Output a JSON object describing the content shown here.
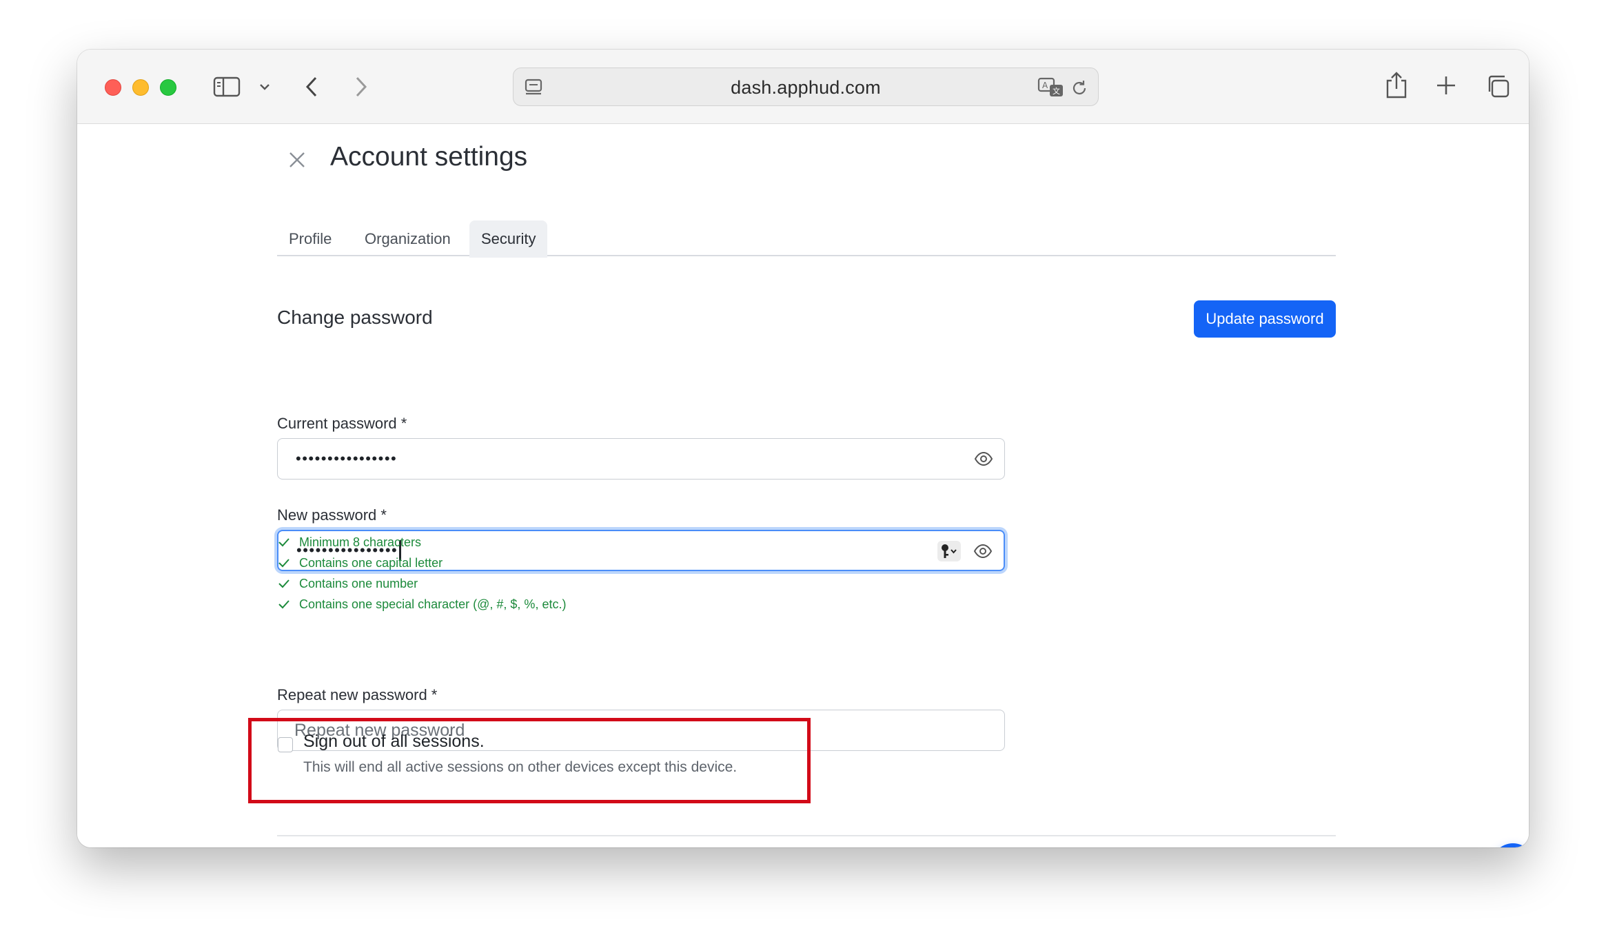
{
  "browser": {
    "url": "dash.apphud.com",
    "icons": [
      "sidebar-icon",
      "chevron-down-icon",
      "back-icon",
      "forward-icon",
      "page-menu-icon",
      "translate-icon",
      "reload-icon",
      "share-icon",
      "new-tab-icon",
      "tabs-overview-icon"
    ]
  },
  "page": {
    "title": "Account settings",
    "tabs": [
      {
        "label": "Profile",
        "active": false
      },
      {
        "label": "Organization",
        "active": false
      },
      {
        "label": "Security",
        "active": true
      }
    ]
  },
  "change_password": {
    "section_title": "Change password",
    "update_button": "Update password",
    "current_password": {
      "label": "Current password *",
      "masked_value": "••••••••••••••••"
    },
    "new_password": {
      "label": "New password *",
      "masked_value": "••••••••••••••••",
      "focused": true
    },
    "requirements": [
      {
        "text": "Minimum 8 characters",
        "met": true
      },
      {
        "text": "Contains one capital letter",
        "met": true
      },
      {
        "text": "Contains one number",
        "met": true
      },
      {
        "text": "Contains one special character (@, #, $, %, etc.)",
        "met": true
      }
    ],
    "repeat_password": {
      "label": "Repeat new password *",
      "placeholder": "Repeat new password",
      "value": ""
    },
    "sign_out": {
      "label": "Sign out of all sessions.",
      "help": "This will end all active sessions on other devices except this device.",
      "checked": false
    }
  },
  "colors": {
    "primary": "#1464f6",
    "success": "#1c8a3b",
    "highlight": "#d20a18",
    "focus_ring": "#4a8df8"
  }
}
